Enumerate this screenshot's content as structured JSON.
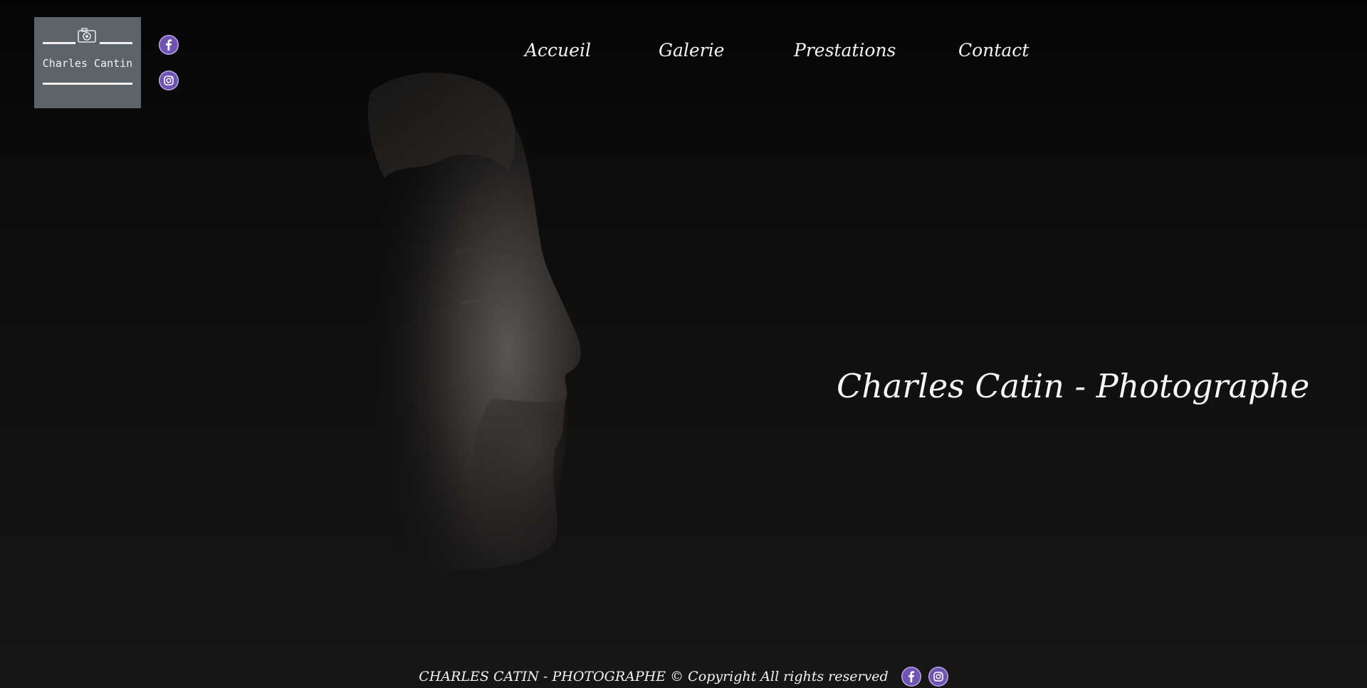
{
  "brand": {
    "logo_text": "Charles Cantin",
    "logo_icon": "camera-icon"
  },
  "social": [
    {
      "name": "facebook",
      "icon": "facebook-icon",
      "glyph": "f"
    },
    {
      "name": "instagram",
      "icon": "instagram-icon"
    }
  ],
  "nav": {
    "items": [
      {
        "label": "Accueil"
      },
      {
        "label": "Galerie"
      },
      {
        "label": "Prestations"
      },
      {
        "label": "Contact"
      }
    ]
  },
  "hero": {
    "title": "Charles Catin - Photographe"
  },
  "footer": {
    "text": "CHARLES CATIN - PHOTOGRAPHE © Copyright All rights reserved"
  },
  "colors": {
    "social_accent": "#6e54b0",
    "logo_background": "#5b646b",
    "page_background": "#0c0c0c"
  }
}
